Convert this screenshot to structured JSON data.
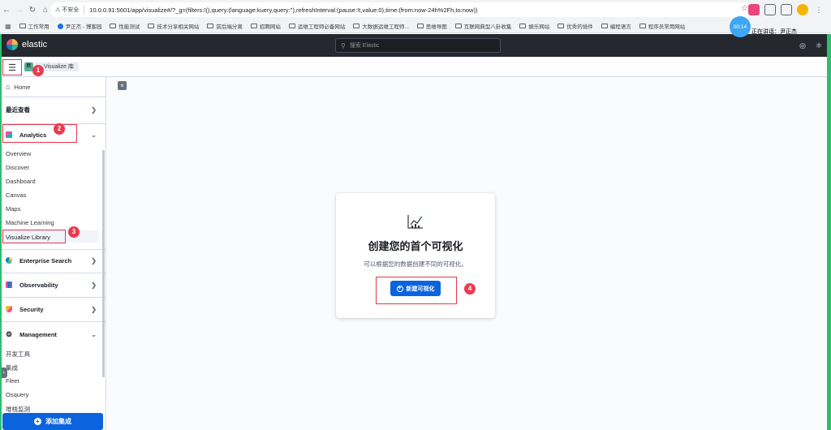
{
  "browser": {
    "insecure_label": "不安全",
    "url": "10.0.0.91:5601/app/visualize#/?_g=(filters:!(),query:(language:kuery,query:''),refreshInterval:(pause:!t,value:0),time:(from:now-24h%2Fh,to:now))",
    "bookmarks": [
      "工作常用",
      "尹正杰 - 博客园",
      "性能测试",
      "技术分享相关网站",
      "前后端分离",
      "招聘网站",
      "运维工程师必备网站",
      "大数据运维工程师...",
      "思维导图",
      "互联网典型八卦收集",
      "娱乐网站",
      "优秀的插件",
      "编程语言",
      "程序员常用网站"
    ],
    "timer": "00:14",
    "speaking": "正在讲话：尹正杰"
  },
  "header": {
    "brand": "elastic",
    "search_placeholder": "搜索 Elastic"
  },
  "breadcrumb": {
    "space_initial": "默",
    "current": "Visualize 库"
  },
  "sidebar": {
    "home": "Home",
    "recent": "最近查看",
    "analytics": "Analytics",
    "analytics_items": [
      "Overview",
      "Discover",
      "Dashboard",
      "Canvas",
      "Maps",
      "Machine Learning",
      "Visualize Library"
    ],
    "enterprise_search": "Enterprise Search",
    "observability": "Observability",
    "security": "Security",
    "management": "Management",
    "management_items": [
      "开发工具",
      "集成",
      "Fleet",
      "Osquery",
      "堆栈监测"
    ],
    "add_integration": "添加集成"
  },
  "empty_state": {
    "title": "创建您的首个可视化",
    "description": "可以根据您的数据创建不同的可视化。",
    "button": "新建可视化"
  },
  "annotations": [
    "1",
    "2",
    "3",
    "4"
  ],
  "colors": {
    "header_bg": "#25282f",
    "primary": "#0b64dd",
    "annotation_red": "#ec3a4e"
  }
}
